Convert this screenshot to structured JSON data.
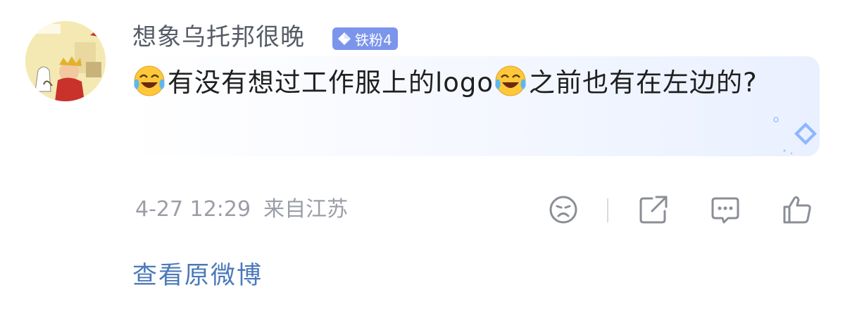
{
  "comment": {
    "username": "想象乌托邦很晚",
    "badge": {
      "label": "铁粉4",
      "icon": "diamond-icon",
      "color": "#7b95ec"
    },
    "text_part1": "有没有想过工作服上的logo",
    "text_part2": "之前也有在左边的?",
    "emoji": "laughing-crying-emoji",
    "timestamp": "4-27 12:29",
    "location": "来自江苏",
    "view_original": "查看原微博"
  },
  "actions": [
    {
      "name": "dislike-icon"
    },
    {
      "name": "share-icon"
    },
    {
      "name": "comment-icon"
    },
    {
      "name": "like-icon"
    }
  ],
  "colors": {
    "link": "#4b79b9",
    "meta": "#9a9ea6",
    "text": "#1f1f1f"
  }
}
